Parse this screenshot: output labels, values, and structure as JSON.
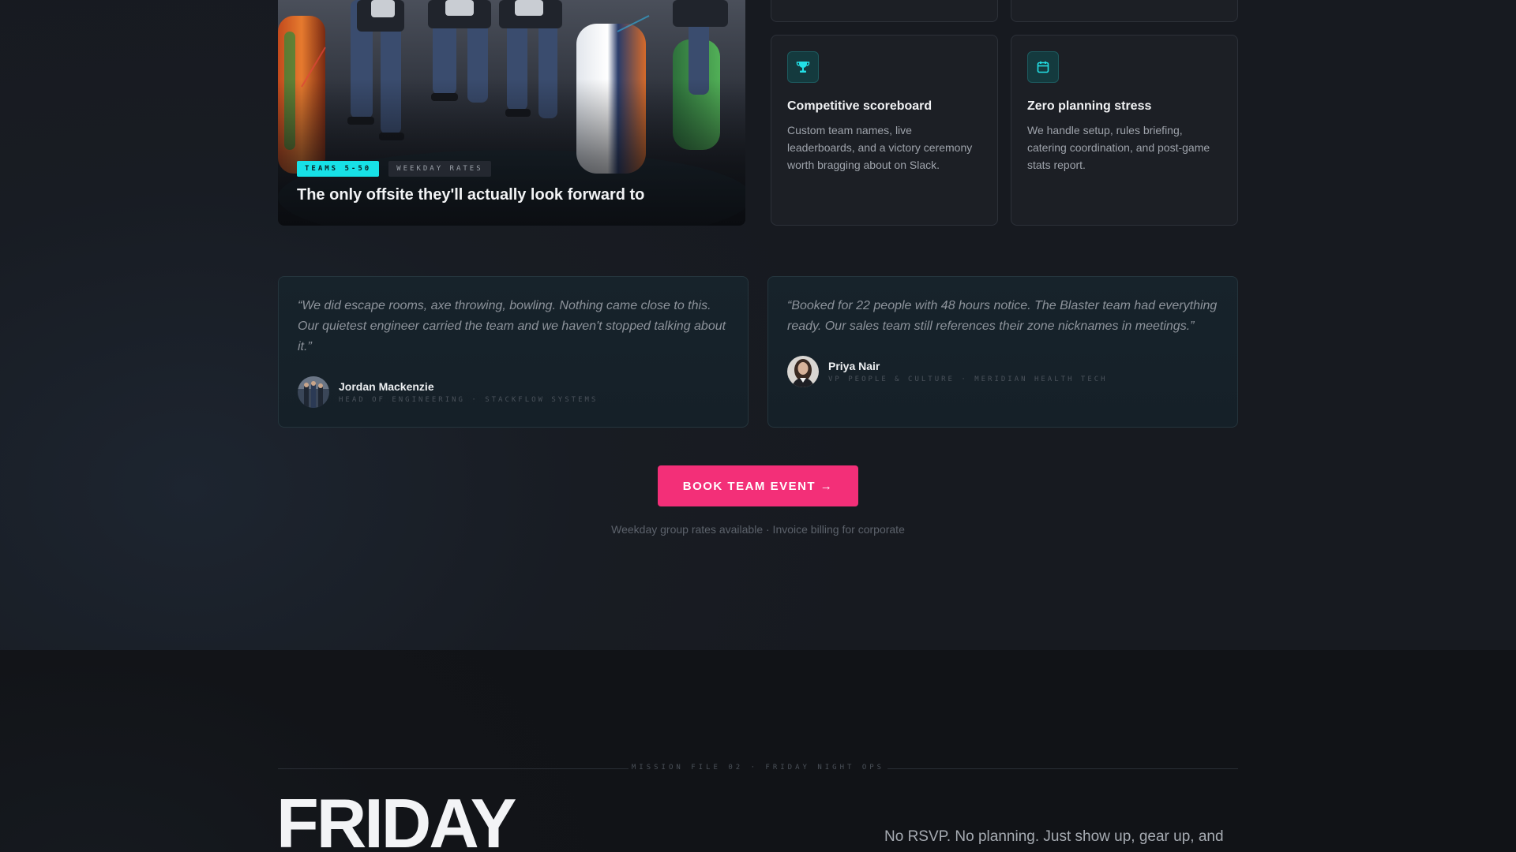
{
  "hero": {
    "tag_primary": "TEAMS 5-50",
    "tag_secondary": "WEEKDAY RATES",
    "title": "The only offsite they'll actually look forward to"
  },
  "features": [
    {
      "icon": "trophy-icon",
      "title": "Competitive scoreboard",
      "description": "Custom team names, live leaderboards, and a victory ceremony worth bragging about on Slack."
    },
    {
      "icon": "calendar-icon",
      "title": "Zero planning stress",
      "description": "We handle setup, rules briefing, catering coordination, and post-game stats report."
    }
  ],
  "testimonials": [
    {
      "quote": "“We did escape rooms, axe throwing, bowling. Nothing came close to this. Our quietest engineer carried the team and we haven't stopped talking about it.”",
      "name": "Jordan Mackenzie",
      "role": "HEAD OF ENGINEERING · STACKFLOW SYSTEMS"
    },
    {
      "quote": "“Booked for 22 people with 48 hours notice. The Blaster team had everything ready. Our sales team still references their zone nicknames in meetings.”",
      "name": "Priya Nair",
      "role": "VP PEOPLE & CULTURE · MERIDIAN HEALTH TECH"
    }
  ],
  "cta": {
    "label": "BOOK TEAM EVENT →",
    "note": "Weekday group rates available · Invoice billing for corporate"
  },
  "mission": {
    "label": "MISSION FILE 02 · FRIDAY NIGHT OPS",
    "heading": "FRIDAY",
    "description": "No RSVP. No planning. Just show up, gear up, and"
  },
  "colors": {
    "accent_cyan": "#17e1e6",
    "accent_pink": "#f32f78",
    "background": "#181b21"
  }
}
